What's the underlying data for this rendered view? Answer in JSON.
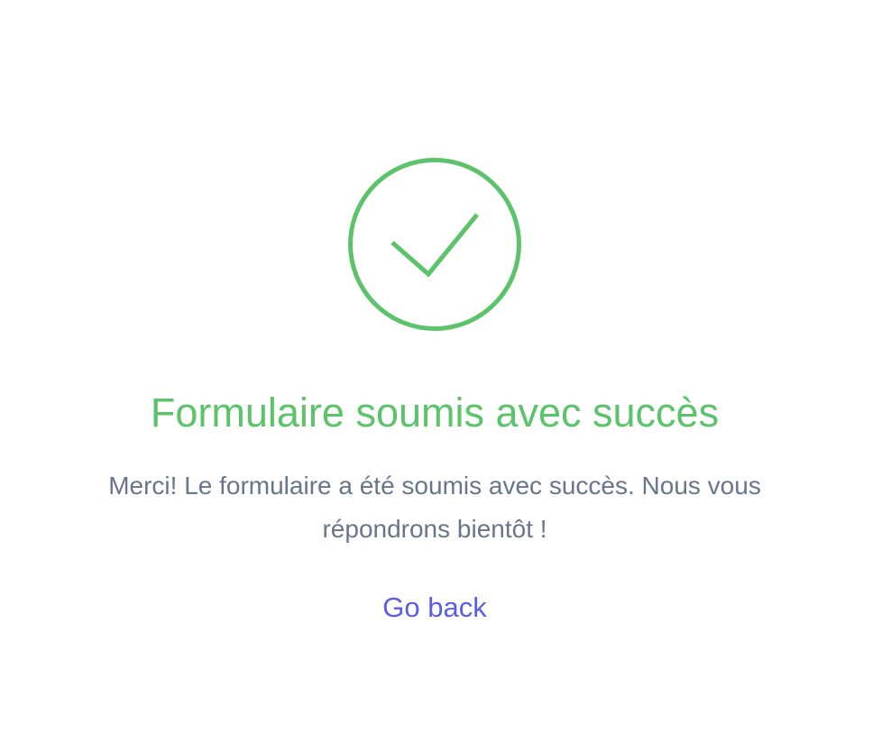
{
  "success": {
    "icon": "check-circle-icon",
    "color": "#5cc36b",
    "title": "Formulaire soumis avec succès",
    "message": "Merci! Le formulaire a été soumis avec succès. Nous vous répondrons bientôt !",
    "message_color": "#69758c"
  },
  "actions": {
    "go_back_label": "Go back",
    "link_color": "#5a5ee6"
  }
}
